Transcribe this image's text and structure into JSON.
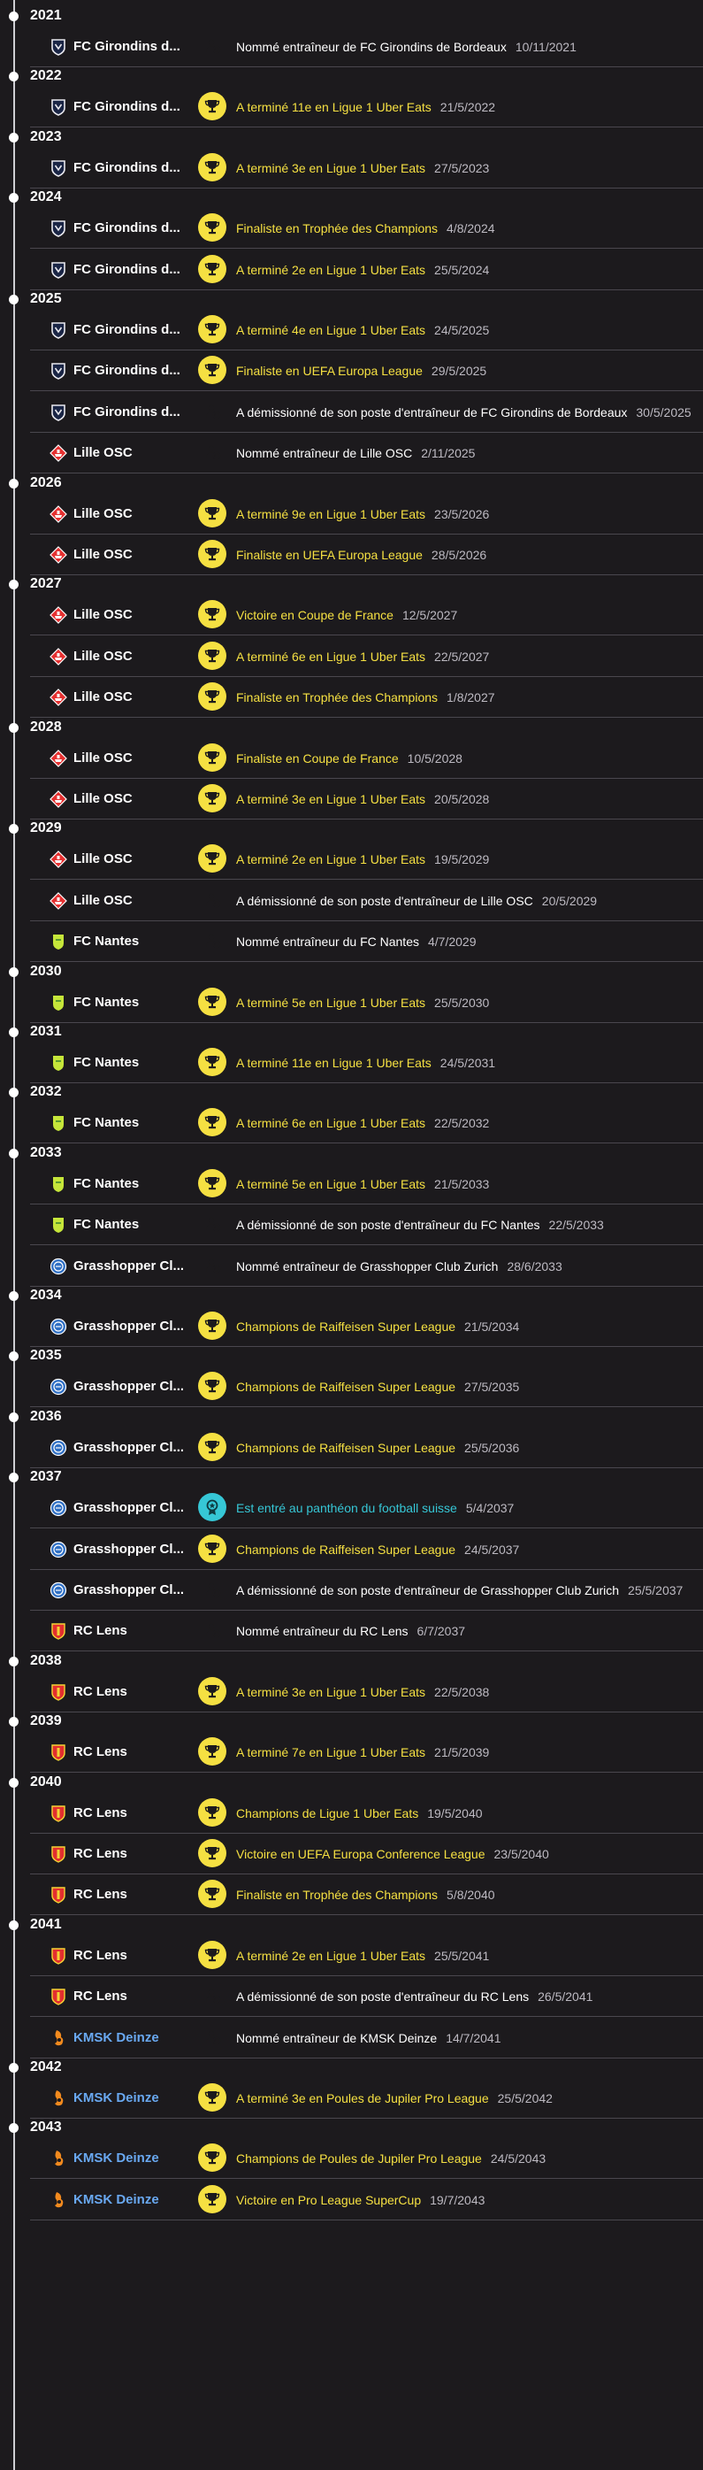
{
  "colors": {
    "trophy": "#f5e042",
    "manager": "#6fcf72",
    "hall_of_fame": "#36c7d6",
    "background": "#1c1a1d"
  },
  "timeline": [
    {
      "year": "2021",
      "entries": [
        {
          "club": "FC Girondins de Bordeaux",
          "club_display": "FC Girondins d...",
          "badge": "bordeaux",
          "type": "manager",
          "text": "Nommé entraîneur de FC Girondins de Bordeaux",
          "date": "10/11/2021"
        }
      ]
    },
    {
      "year": "2022",
      "entries": [
        {
          "club": "FC Girondins de Bordeaux",
          "club_display": "FC Girondins d...",
          "badge": "bordeaux",
          "type": "trophy",
          "text": "A terminé 11e en Ligue 1 Uber Eats",
          "date": "21/5/2022"
        }
      ]
    },
    {
      "year": "2023",
      "entries": [
        {
          "club": "FC Girondins de Bordeaux",
          "club_display": "FC Girondins d...",
          "badge": "bordeaux",
          "type": "trophy",
          "text": "A terminé 3e en Ligue 1 Uber Eats",
          "date": "27/5/2023"
        }
      ]
    },
    {
      "year": "2024",
      "entries": [
        {
          "club": "FC Girondins de Bordeaux",
          "club_display": "FC Girondins d...",
          "badge": "bordeaux",
          "type": "trophy",
          "text": "Finaliste en Trophée des Champions",
          "date": "4/8/2024"
        },
        {
          "club": "FC Girondins de Bordeaux",
          "club_display": "FC Girondins d...",
          "badge": "bordeaux",
          "type": "trophy",
          "text": "A terminé 2e en Ligue 1 Uber Eats",
          "date": "25/5/2024"
        }
      ]
    },
    {
      "year": "2025",
      "entries": [
        {
          "club": "FC Girondins de Bordeaux",
          "club_display": "FC Girondins d...",
          "badge": "bordeaux",
          "type": "trophy",
          "text": "A terminé 4e en Ligue 1 Uber Eats",
          "date": "24/5/2025"
        },
        {
          "club": "FC Girondins de Bordeaux",
          "club_display": "FC Girondins d...",
          "badge": "bordeaux",
          "type": "trophy",
          "text": "Finaliste en UEFA Europa League",
          "date": "29/5/2025"
        },
        {
          "club": "FC Girondins de Bordeaux",
          "club_display": "FC Girondins d...",
          "badge": "bordeaux",
          "type": "manager",
          "text": "A démissionné de son poste d'entraîneur de FC Girondins de Bordeaux",
          "date": "30/5/2025"
        },
        {
          "club": "Lille OSC",
          "club_display": "Lille OSC",
          "badge": "lille",
          "type": "manager",
          "text": "Nommé entraîneur de Lille OSC",
          "date": "2/11/2025"
        }
      ]
    },
    {
      "year": "2026",
      "entries": [
        {
          "club": "Lille OSC",
          "club_display": "Lille OSC",
          "badge": "lille",
          "type": "trophy",
          "text": "A terminé 9e en Ligue 1 Uber Eats",
          "date": "23/5/2026"
        },
        {
          "club": "Lille OSC",
          "club_display": "Lille OSC",
          "badge": "lille",
          "type": "trophy",
          "text": "Finaliste en UEFA Europa League",
          "date": "28/5/2026"
        }
      ]
    },
    {
      "year": "2027",
      "entries": [
        {
          "club": "Lille OSC",
          "club_display": "Lille OSC",
          "badge": "lille",
          "type": "trophy",
          "text": "Victoire en Coupe de France",
          "date": "12/5/2027"
        },
        {
          "club": "Lille OSC",
          "club_display": "Lille OSC",
          "badge": "lille",
          "type": "trophy",
          "text": "A terminé 6e en Ligue 1 Uber Eats",
          "date": "22/5/2027"
        },
        {
          "club": "Lille OSC",
          "club_display": "Lille OSC",
          "badge": "lille",
          "type": "trophy",
          "text": "Finaliste en Trophée des Champions",
          "date": "1/8/2027"
        }
      ]
    },
    {
      "year": "2028",
      "entries": [
        {
          "club": "Lille OSC",
          "club_display": "Lille OSC",
          "badge": "lille",
          "type": "trophy",
          "text": "Finaliste en Coupe de France",
          "date": "10/5/2028"
        },
        {
          "club": "Lille OSC",
          "club_display": "Lille OSC",
          "badge": "lille",
          "type": "trophy",
          "text": "A terminé 3e en Ligue 1 Uber Eats",
          "date": "20/5/2028"
        }
      ]
    },
    {
      "year": "2029",
      "entries": [
        {
          "club": "Lille OSC",
          "club_display": "Lille OSC",
          "badge": "lille",
          "type": "trophy",
          "text": "A terminé 2e en Ligue 1 Uber Eats",
          "date": "19/5/2029"
        },
        {
          "club": "Lille OSC",
          "club_display": "Lille OSC",
          "badge": "lille",
          "type": "manager",
          "text": "A démissionné de son poste d'entraîneur de Lille OSC",
          "date": "20/5/2029"
        },
        {
          "club": "FC Nantes",
          "club_display": "FC Nantes",
          "badge": "nantes",
          "type": "manager",
          "text": "Nommé entraîneur du FC Nantes",
          "date": "4/7/2029"
        }
      ]
    },
    {
      "year": "2030",
      "entries": [
        {
          "club": "FC Nantes",
          "club_display": "FC Nantes",
          "badge": "nantes",
          "type": "trophy",
          "text": "A terminé 5e en Ligue 1 Uber Eats",
          "date": "25/5/2030"
        }
      ]
    },
    {
      "year": "2031",
      "entries": [
        {
          "club": "FC Nantes",
          "club_display": "FC Nantes",
          "badge": "nantes",
          "type": "trophy",
          "text": "A terminé 11e en Ligue 1 Uber Eats",
          "date": "24/5/2031"
        }
      ]
    },
    {
      "year": "2032",
      "entries": [
        {
          "club": "FC Nantes",
          "club_display": "FC Nantes",
          "badge": "nantes",
          "type": "trophy",
          "text": "A terminé 6e en Ligue 1 Uber Eats",
          "date": "22/5/2032"
        }
      ]
    },
    {
      "year": "2033",
      "entries": [
        {
          "club": "FC Nantes",
          "club_display": "FC Nantes",
          "badge": "nantes",
          "type": "trophy",
          "text": "A terminé 5e en Ligue 1 Uber Eats",
          "date": "21/5/2033"
        },
        {
          "club": "FC Nantes",
          "club_display": "FC Nantes",
          "badge": "nantes",
          "type": "manager",
          "text": "A démissionné de son poste d'entraîneur du FC Nantes",
          "date": "22/5/2033"
        },
        {
          "club": "Grasshopper Club Zurich",
          "club_display": "Grasshopper Cl...",
          "badge": "grasshopper",
          "type": "manager",
          "text": "Nommé entraîneur de Grasshopper Club Zurich",
          "date": "28/6/2033"
        }
      ]
    },
    {
      "year": "2034",
      "entries": [
        {
          "club": "Grasshopper Club Zurich",
          "club_display": "Grasshopper Cl...",
          "badge": "grasshopper",
          "type": "trophy",
          "text": "Champions de Raiffeisen Super League",
          "date": "21/5/2034"
        }
      ]
    },
    {
      "year": "2035",
      "entries": [
        {
          "club": "Grasshopper Club Zurich",
          "club_display": "Grasshopper Cl...",
          "badge": "grasshopper",
          "type": "trophy",
          "text": "Champions de Raiffeisen Super League",
          "date": "27/5/2035"
        }
      ]
    },
    {
      "year": "2036",
      "entries": [
        {
          "club": "Grasshopper Club Zurich",
          "club_display": "Grasshopper Cl...",
          "badge": "grasshopper",
          "type": "trophy",
          "text": "Champions de Raiffeisen Super League",
          "date": "25/5/2036"
        }
      ]
    },
    {
      "year": "2037",
      "entries": [
        {
          "club": "Grasshopper Club Zurich",
          "club_display": "Grasshopper Cl...",
          "badge": "grasshopper",
          "type": "star",
          "text": "Est entré au panthéon du football suisse",
          "date": "5/4/2037"
        },
        {
          "club": "Grasshopper Club Zurich",
          "club_display": "Grasshopper Cl...",
          "badge": "grasshopper",
          "type": "trophy",
          "text": "Champions de Raiffeisen Super League",
          "date": "24/5/2037"
        },
        {
          "club": "Grasshopper Club Zurich",
          "club_display": "Grasshopper Cl...",
          "badge": "grasshopper",
          "type": "manager",
          "text": "A démissionné de son poste d'entraîneur de Grasshopper Club Zurich",
          "date": "25/5/2037"
        },
        {
          "club": "RC Lens",
          "club_display": "RC Lens",
          "badge": "lens",
          "type": "manager",
          "text": "Nommé entraîneur du RC Lens",
          "date": "6/7/2037"
        }
      ]
    },
    {
      "year": "2038",
      "entries": [
        {
          "club": "RC Lens",
          "club_display": "RC Lens",
          "badge": "lens",
          "type": "trophy",
          "text": "A terminé 3e en Ligue 1 Uber Eats",
          "date": "22/5/2038"
        }
      ]
    },
    {
      "year": "2039",
      "entries": [
        {
          "club": "RC Lens",
          "club_display": "RC Lens",
          "badge": "lens",
          "type": "trophy",
          "text": "A terminé 7e en Ligue 1 Uber Eats",
          "date": "21/5/2039"
        }
      ]
    },
    {
      "year": "2040",
      "entries": [
        {
          "club": "RC Lens",
          "club_display": "RC Lens",
          "badge": "lens",
          "type": "trophy",
          "text": "Champions de Ligue 1 Uber Eats",
          "date": "19/5/2040"
        },
        {
          "club": "RC Lens",
          "club_display": "RC Lens",
          "badge": "lens",
          "type": "trophy",
          "text": "Victoire en UEFA Europa Conference League",
          "date": "23/5/2040"
        },
        {
          "club": "RC Lens",
          "club_display": "RC Lens",
          "badge": "lens",
          "type": "trophy",
          "text": "Finaliste en Trophée des Champions",
          "date": "5/8/2040"
        }
      ]
    },
    {
      "year": "2041",
      "entries": [
        {
          "club": "RC Lens",
          "club_display": "RC Lens",
          "badge": "lens",
          "type": "trophy",
          "text": "A terminé 2e en Ligue 1 Uber Eats",
          "date": "25/5/2041"
        },
        {
          "club": "RC Lens",
          "club_display": "RC Lens",
          "badge": "lens",
          "type": "manager",
          "text": "A démissionné de son poste d'entraîneur du RC Lens",
          "date": "26/5/2041"
        },
        {
          "club": "KMSK Deinze",
          "club_display": "KMSK Deinze",
          "badge": "deinze",
          "type": "manager",
          "text": "Nommé entraîneur de KMSK Deinze",
          "date": "14/7/2041"
        }
      ]
    },
    {
      "year": "2042",
      "entries": [
        {
          "club": "KMSK Deinze",
          "club_display": "KMSK Deinze",
          "badge": "deinze",
          "type": "trophy",
          "text": "A terminé 3e en Poules de Jupiler Pro League",
          "date": "25/5/2042"
        }
      ]
    },
    {
      "year": "2043",
      "entries": [
        {
          "club": "KMSK Deinze",
          "club_display": "KMSK Deinze",
          "badge": "deinze",
          "type": "trophy",
          "text": "Champions de Poules de Jupiler Pro League",
          "date": "24/5/2043"
        },
        {
          "club": "KMSK Deinze",
          "club_display": "KMSK Deinze",
          "badge": "deinze",
          "type": "trophy",
          "text": "Victoire en Pro League SuperCup",
          "date": "19/7/2043"
        }
      ]
    }
  ]
}
